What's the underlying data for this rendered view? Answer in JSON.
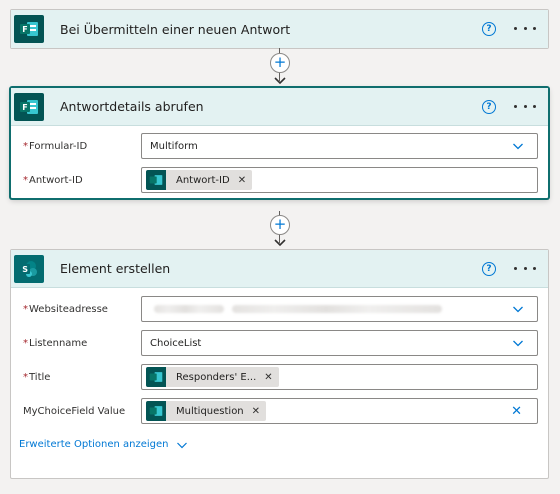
{
  "card1": {
    "title": "Bei Übermitteln einer neuen Antwort",
    "app_icon": "forms-icon",
    "help_label": "?"
  },
  "connector1": {
    "plus_label": "+"
  },
  "card2": {
    "title": "Antwortdetails abrufen",
    "app_icon": "forms-icon",
    "help_label": "?",
    "fields": {
      "form_id": {
        "label": "Formular-ID",
        "value": "Multiform",
        "required": "*"
      },
      "response_id": {
        "label": "Antwort-ID",
        "token": "Antwort-ID",
        "required": "*"
      }
    }
  },
  "connector2": {
    "plus_label": "+"
  },
  "card3": {
    "title": "Element erstellen",
    "app_icon": "sharepoint-icon",
    "help_label": "?",
    "fields": {
      "site": {
        "label": "Websiteadresse",
        "required": "*",
        "value_obscured": true
      },
      "list": {
        "label": "Listenname",
        "value": "ChoiceList",
        "required": "*"
      },
      "title": {
        "label": "Title",
        "token": "Responders' E...",
        "required": "*"
      },
      "choice": {
        "label": "MyChoiceField Value",
        "token": "Multiquestion"
      }
    },
    "advanced_link": "Erweiterte Optionen anzeigen"
  },
  "colors": {
    "header_bg": "#e3f2f2",
    "forms_brand": "#035454",
    "sharepoint_brand": "#036c70",
    "link_blue": "#0078d4",
    "required_red": "#a4262c"
  }
}
